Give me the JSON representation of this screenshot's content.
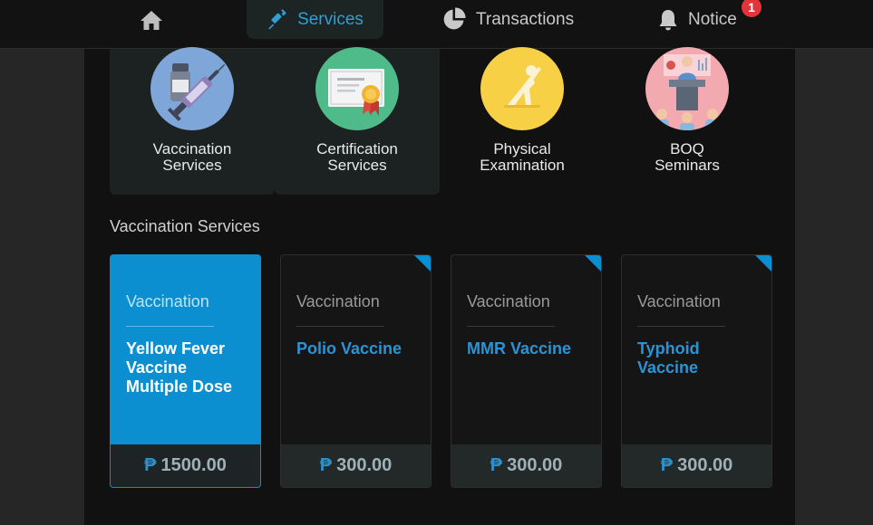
{
  "nav": {
    "home_icon": "home-icon",
    "services_label": "Services",
    "transactions_label": "Transactions",
    "notice_label": "Notice",
    "notice_count": "1"
  },
  "categories": [
    {
      "label": "Vaccination\nServices",
      "icon": "syringe-vial-icon"
    },
    {
      "label": "Certification\nServices",
      "icon": "certificate-icon"
    },
    {
      "label": "Physical\nExamination",
      "icon": "stretching-person-icon"
    },
    {
      "label": "BOQ\nSeminars",
      "icon": "seminar-speaker-icon"
    }
  ],
  "section_title": "Vaccination Services",
  "cards": [
    {
      "type": "Vaccination",
      "name": "Yellow Fever Vaccine Multiple Dose",
      "currency": "₱",
      "price": "1500.00"
    },
    {
      "type": "Vaccination",
      "name": "Polio Vaccine",
      "currency": "₱",
      "price": "300.00"
    },
    {
      "type": "Vaccination",
      "name": "MMR Vaccine",
      "currency": "₱",
      "price": "300.00"
    },
    {
      "type": "Vaccination",
      "name": "Typhoid Vaccine",
      "currency": "₱",
      "price": "300.00"
    }
  ],
  "colors": {
    "accent": "#0b8fd0",
    "badge": "#e2353a",
    "background": "#111111"
  }
}
